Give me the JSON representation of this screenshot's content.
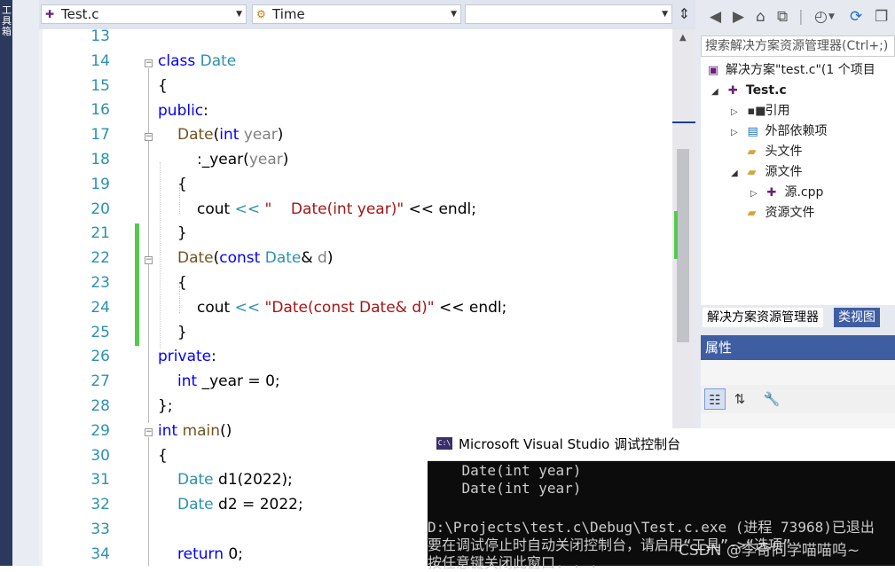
{
  "toolbox": {
    "label": "工具箱"
  },
  "nav": {
    "file_combo": "Test.c",
    "member_combo": "Time",
    "scope_combo": ""
  },
  "line_numbers": [
    "13",
    "14",
    "15",
    "16",
    "17",
    "18",
    "19",
    "20",
    "21",
    "22",
    "23",
    "24",
    "25",
    "26",
    "27",
    "28",
    "29",
    "30",
    "31",
    "32",
    "33",
    "34"
  ],
  "code": {
    "l14": {
      "kw": "class",
      "ty": "Date"
    },
    "l15": "{",
    "l16": {
      "kw": "public",
      "punct": ":"
    },
    "l17": {
      "fn": "Date",
      "p1": "(",
      "kw": "int",
      "pm": "year",
      "p2": ")"
    },
    "l18": {
      "p1": ":",
      "ob": "_year",
      "p2": "(",
      "pm": "year",
      "p3": ")"
    },
    "l19": "{",
    "l20": {
      "id": "cout",
      "op": "<<",
      "st": "\"    Date(int year)\"",
      "op2": "<<",
      "id2": "endl;"
    },
    "l21": "}",
    "l22": {
      "fn": "Date",
      "p1": "(",
      "kw": "const",
      "ty": "Date",
      "amp": "&",
      "pm": "d",
      "p2": ")"
    },
    "l23": "{",
    "l24": {
      "id": "cout",
      "op": "<<",
      "st": "\"Date(const Date& d)\"",
      "op2": "<<",
      "id2": "endl;"
    },
    "l25": "}",
    "l26": {
      "kw": "private",
      "punct": ":"
    },
    "l27": {
      "kw": "int",
      "ob": "_year",
      "rest": " = 0;"
    },
    "l28": "};",
    "l29": {
      "kw": "int",
      "fn": "main",
      "rest": "()"
    },
    "l30": "{",
    "l31": {
      "ty": "Date",
      "rest": " d1(2022);"
    },
    "l32": {
      "ty": "Date",
      "rest": " d2 = 2022;"
    },
    "l34": {
      "kw": "return",
      "rest": " 0;"
    }
  },
  "solution_explorer": {
    "search_placeholder": "搜索解决方案资源管理器(Ctrl+;)",
    "items": [
      {
        "label": "解决方案\"test.c\"(1 个项目"
      },
      {
        "label": "Test.c"
      },
      {
        "label": "引用"
      },
      {
        "label": "外部依赖项"
      },
      {
        "label": "头文件"
      },
      {
        "label": "源文件"
      },
      {
        "label": "源.cpp"
      },
      {
        "label": "资源文件"
      }
    ],
    "tabs": [
      "解决方案资源管理器",
      "类视图"
    ]
  },
  "properties": {
    "title": "属性"
  },
  "console": {
    "title": "Microsoft Visual Studio 调试控制台",
    "lines": [
      "    Date(int year)",
      "    Date(int year)",
      "",
      "D:\\Projects\\test.c\\Debug\\Test.c.exe (进程 73968)已退出",
      "要在调试停止时自动关闭控制台，请启用“工具”->“选项”",
      "按任意键关闭此窗口. . ."
    ]
  },
  "watermark": "CSDN @李奇同学喵喵呜~"
}
